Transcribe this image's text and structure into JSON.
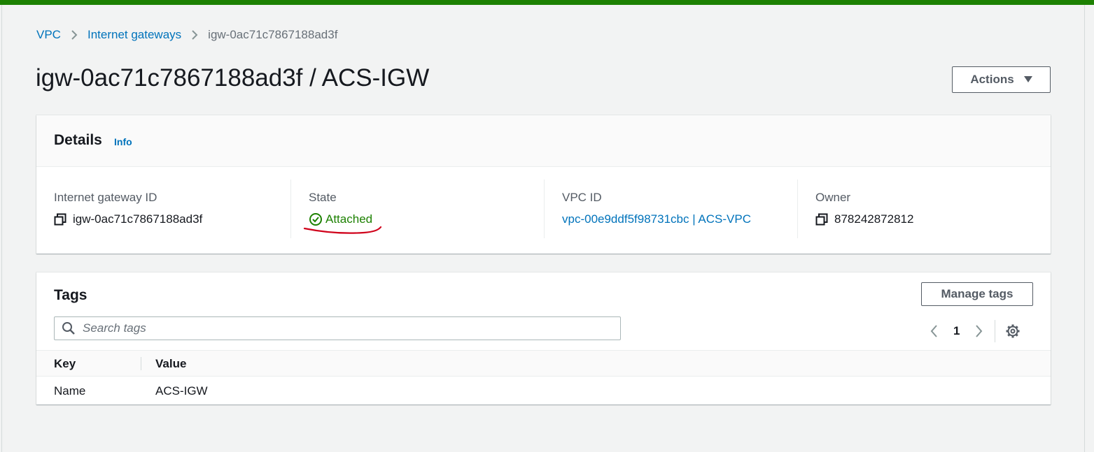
{
  "breadcrumb": {
    "items": [
      "VPC",
      "Internet gateways"
    ],
    "current": "igw-0ac71c7867188ad3f"
  },
  "page_title": "igw-0ac71c7867188ad3f / ACS-IGW",
  "actions_label": "Actions",
  "details": {
    "title": "Details",
    "info_label": "Info",
    "fields": {
      "igw_id": {
        "label": "Internet gateway ID",
        "value": "igw-0ac71c7867188ad3f"
      },
      "state": {
        "label": "State",
        "value": "Attached"
      },
      "vpc_id": {
        "label": "VPC ID",
        "value": "vpc-00e9ddf5f98731cbc | ACS-VPC"
      },
      "owner": {
        "label": "Owner",
        "value": "878242872812"
      }
    }
  },
  "tags": {
    "title": "Tags",
    "manage_label": "Manage tags",
    "search_placeholder": "Search tags",
    "page_number": "1",
    "columns": {
      "key": "Key",
      "value": "Value"
    },
    "rows": [
      {
        "key": "Name",
        "value": "ACS-IGW"
      }
    ]
  },
  "colors": {
    "accent_green": "#1d8102",
    "link_blue": "#0073bb",
    "annotation_red": "#d0021b"
  },
  "icons": [
    "chevron-right-icon",
    "copy-icon",
    "check-circle-icon",
    "search-icon",
    "chevron-left-icon",
    "settings-gear-icon",
    "caret-down-icon"
  ]
}
